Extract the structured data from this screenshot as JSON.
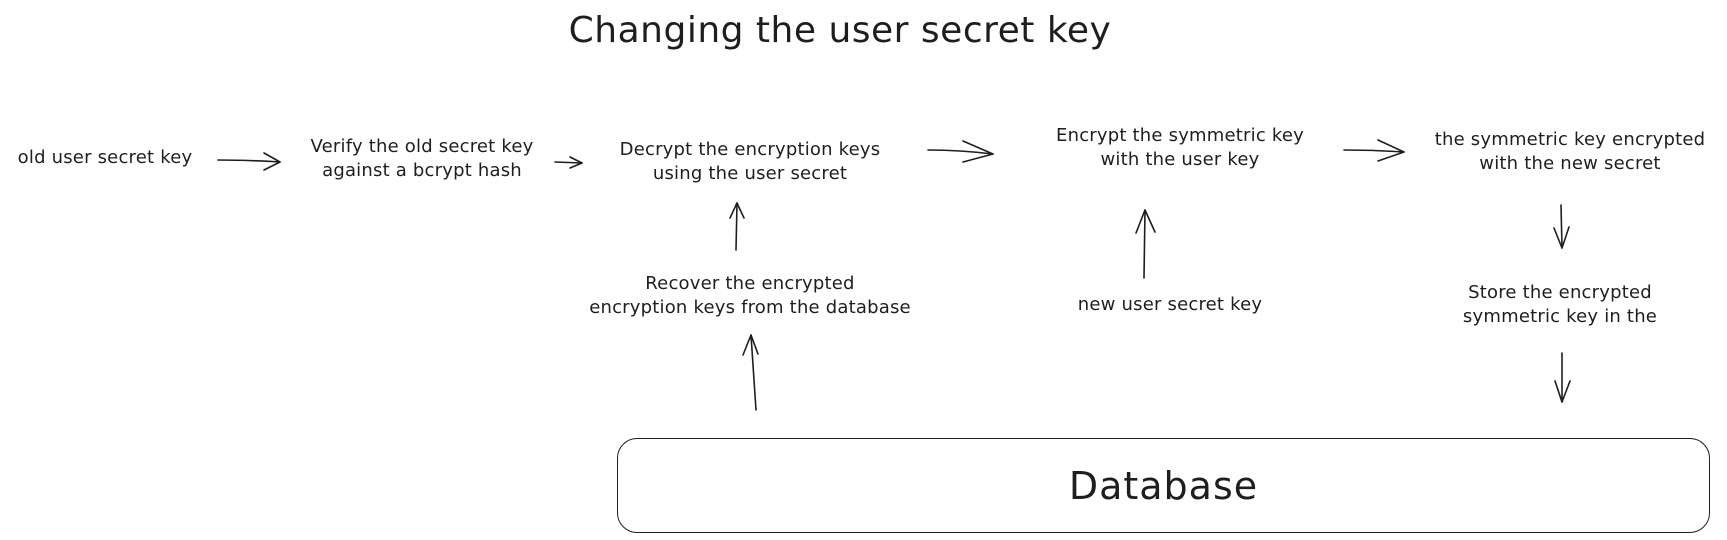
{
  "title": "Changing the user secret key",
  "nodes": {
    "old_user_secret_key": [
      "old user secret key"
    ],
    "verify": [
      "Verify the old secret key",
      "against a bcrypt hash"
    ],
    "decrypt": [
      "Decrypt the encryption keys",
      "using the user secret"
    ],
    "encrypt": [
      "Encrypt the symmetric key",
      "with the user key"
    ],
    "symmetric_encrypted": [
      "the symmetric key encrypted",
      "with the new secret"
    ],
    "recover": [
      "Recover the encrypted",
      "encryption keys from the database"
    ],
    "new_user_secret_key": [
      "new user secret key"
    ],
    "store": [
      "Store the encrypted",
      "symmetric key in the"
    ]
  },
  "database": {
    "label": "Database"
  },
  "edges": [
    {
      "from": "old user secret key",
      "to": "Verify the old secret key"
    },
    {
      "from": "Verify the old secret key",
      "to": "Decrypt the encryption keys"
    },
    {
      "from": "Decrypt the encryption keys",
      "to": "Encrypt the symmetric key"
    },
    {
      "from": "Encrypt the symmetric key",
      "to": "the symmetric key encrypted"
    },
    {
      "from": "Recover the encrypted",
      "to": "Decrypt the encryption keys"
    },
    {
      "from": "Database",
      "to": "Recover the encrypted"
    },
    {
      "from": "new user secret key",
      "to": "Encrypt the symmetric key"
    },
    {
      "from": "the symmetric key encrypted",
      "to": "Store the encrypted"
    },
    {
      "from": "Store the encrypted",
      "to": "Database"
    }
  ],
  "colors": {
    "stroke": "#1e1e1e",
    "background": "#ffffff"
  }
}
